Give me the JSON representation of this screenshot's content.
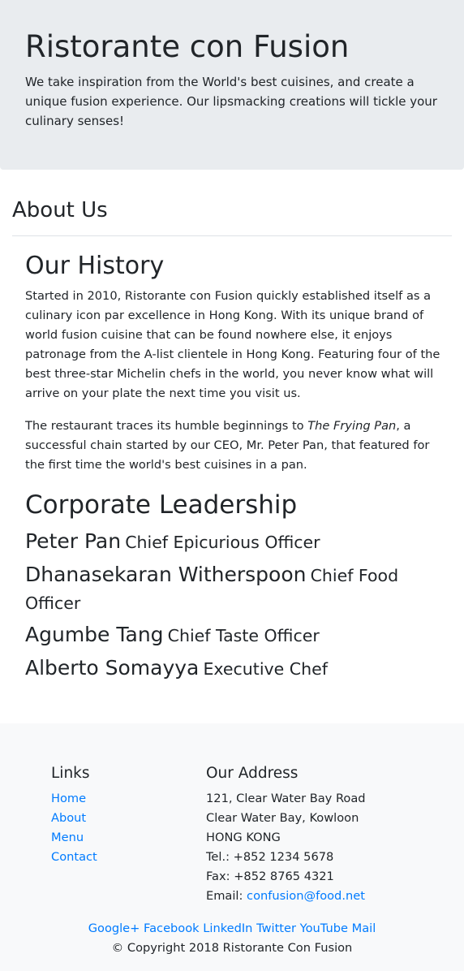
{
  "jumbotron": {
    "title": "Ristorante con Fusion",
    "lead": "We take inspiration from the World's best cuisines, and create a unique fusion experience. Our lipsmacking creations will tickle your culinary senses!"
  },
  "about": {
    "heading": "About Us"
  },
  "history": {
    "title": "Our History",
    "para1": "Started in 2010, Ristorante con Fusion quickly established itself as a culinary icon par excellence in Hong Kong. With its unique brand of world fusion cuisine that can be found nowhere else, it enjoys patronage from the A-list clientele in Hong Kong. Featuring four of the best three-star Michelin chefs in the world, you never know what will arrive on your plate the next time you visit us.",
    "para2_before": "The restaurant traces its humble beginnings to ",
    "para2_italic": "The Frying Pan",
    "para2_after": ", a successful chain started by our CEO, Mr. Peter Pan, that featured for the first time the world's best cuisines in a pan."
  },
  "leadership": {
    "title": "Corporate Leadership",
    "leaders": [
      {
        "name": "Peter Pan",
        "role": "Chief Epicurious Officer"
      },
      {
        "name": "Dhanasekaran Witherspoon",
        "role": "Chief Food Officer"
      },
      {
        "name": "Agumbe Tang",
        "role": "Chief Taste Officer"
      },
      {
        "name": "Alberto Somayya",
        "role": "Executive Chef"
      }
    ]
  },
  "footer": {
    "links_heading": "Links",
    "links": [
      "Home",
      "About",
      "Menu",
      "Contact"
    ],
    "address_heading": "Our Address",
    "address_lines": [
      "121, Clear Water Bay Road",
      "Clear Water Bay, Kowloon",
      "HONG KONG",
      "Tel.: +852 1234 5678",
      "Fax: +852 8765 4321"
    ],
    "email_label": "Email: ",
    "email": "confusion@food.net",
    "social": [
      "Google+",
      "Facebook",
      "LinkedIn",
      "Twitter",
      "YouTube",
      "Mail"
    ],
    "copyright": "© Copyright 2018 Ristorante Con Fusion"
  },
  "colors": {
    "link": "#007bff",
    "jumbotron_bg": "#e9ecef",
    "footer_bg": "#f8f9fa",
    "text": "#212529"
  }
}
